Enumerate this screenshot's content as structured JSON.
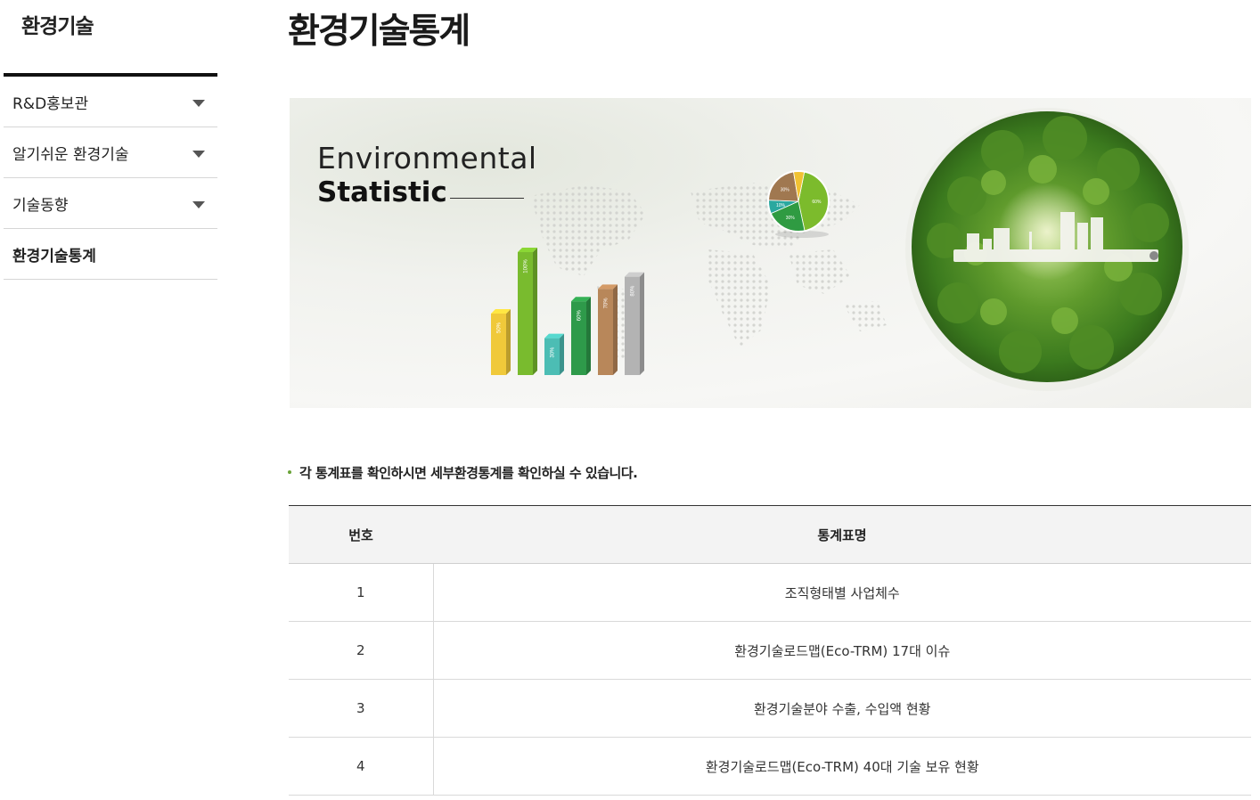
{
  "sidebar": {
    "title": "환경기술",
    "items": [
      {
        "label": "R&D홍보관",
        "expandable": true,
        "active": false
      },
      {
        "label": "알기쉬운 환경기술",
        "expandable": true,
        "active": false
      },
      {
        "label": "기술동향",
        "expandable": true,
        "active": false
      },
      {
        "label": "환경기술통계",
        "expandable": false,
        "active": true
      }
    ]
  },
  "main": {
    "title": "환경기술통계",
    "banner": {
      "line1": "Environmental",
      "line2": "Statistic",
      "bars": [
        {
          "label": "50%",
          "value": 50,
          "color": "#f0c93a"
        },
        {
          "label": "100%",
          "value": 100,
          "color": "#79bb2e"
        },
        {
          "label": "30%",
          "value": 30,
          "color": "#4cbdb4"
        },
        {
          "label": "60%",
          "value": 60,
          "color": "#2e9a4a"
        },
        {
          "label": "70%",
          "value": 70,
          "color": "#b8875a"
        },
        {
          "label": "80%",
          "value": 80,
          "color": "#b3b3b3"
        }
      ],
      "pie": [
        {
          "label": "60%",
          "value": 60,
          "color": "#7cbb2c"
        },
        {
          "label": "30%",
          "value": 30,
          "color": "#2f9b42"
        },
        {
          "label": "10%",
          "value": 10,
          "color": "#2aa89f"
        },
        {
          "label": "30%",
          "value": 30,
          "color": "#a07850"
        },
        {
          "label": "",
          "value": 8,
          "color": "#f1c232"
        }
      ]
    },
    "notice": "각 통계표를 확인하시면 세부환경통계를 확인하실 수 있습니다.",
    "table": {
      "headers": {
        "num": "번호",
        "name": "통계표명"
      },
      "rows": [
        {
          "num": "1",
          "name": "조직형태별 사업체수"
        },
        {
          "num": "2",
          "name": "환경기술로드맵(Eco-TRM) 17대 이슈"
        },
        {
          "num": "3",
          "name": "환경기술분야 수출, 수입액 현황"
        },
        {
          "num": "4",
          "name": "환경기술로드맵(Eco-TRM) 40대 기술 보유 현황"
        }
      ]
    }
  }
}
